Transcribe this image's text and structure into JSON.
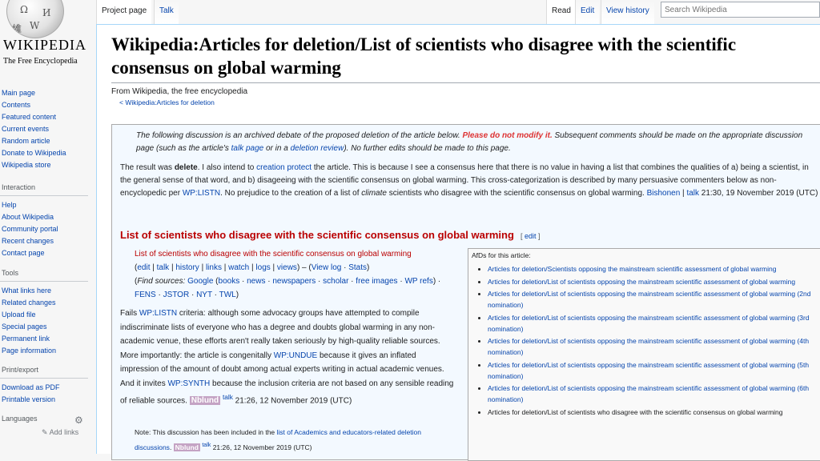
{
  "logo": {
    "wordmark": "WIKIPEDIA",
    "tagline": "The Free Encyclopedia"
  },
  "nav": {
    "main": [
      "Main page",
      "Contents",
      "Featured content",
      "Current events",
      "Random article",
      "Donate to Wikipedia",
      "Wikipedia store"
    ],
    "interaction_heading": "Interaction",
    "interaction": [
      "Help",
      "About Wikipedia",
      "Community portal",
      "Recent changes",
      "Contact page"
    ],
    "tools_heading": "Tools",
    "tools": [
      "What links here",
      "Related changes",
      "Upload file",
      "Special pages",
      "Permanent link",
      "Page information"
    ],
    "print_heading": "Print/export",
    "print": [
      "Download as PDF",
      "Printable version"
    ],
    "languages_heading": "Languages",
    "add_links": "Add links"
  },
  "tabs": {
    "project_page": "Project page",
    "talk": "Talk",
    "read": "Read",
    "edit": "Edit",
    "view_history": "View history"
  },
  "search": {
    "placeholder": "Search Wikipedia"
  },
  "page": {
    "title": "Wikipedia:Articles for deletion/List of scientists who disagree with the scientific consensus on global warming",
    "from": "From Wikipedia, the free encyclopedia",
    "breadcrumb": "< Wikipedia:Articles for deletion"
  },
  "notice": {
    "part1": "The following discussion is an archived debate of the proposed deletion of the article below. ",
    "warning": "Please do not modify it.",
    "part2": " Subsequent comments should be made on the appropriate discussion page (such as the article's ",
    "talk_page": "talk page",
    "part3": " or in a ",
    "deletion_review": "deletion review",
    "part4": "). No further edits should be made to this page."
  },
  "result": {
    "prefix": "The result was ",
    "verdict": "delete",
    "t1": ". I also intend to ",
    "creation_protect": "creation protect",
    "t2": " the article. This is because I see a consensus here that there is no value in having a list that combines the qualities of a) being a scientist, in the general sense of that word, and b) disageeing with the scientific consensus on global warming. This cross-categorization is described by many persuasive commenters below as non-encyclopedic per ",
    "wp_listn": "WP:LISTN",
    "t3": ". No prejudice to the creation of a list of ",
    "climate": "climate",
    "t4": " scientists who disagree with the scientific consensus on global warming. ",
    "user": "Bishonen",
    "talk": "talk",
    "time": " 21:30, 19 November 2019 (UTC)"
  },
  "section": {
    "heading": "List of scientists who disagree with the scientific consensus on global warming",
    "edit": "edit"
  },
  "article_links": {
    "article": "List of scientists who disagree with the scientific consensus on global warming",
    "edit": "edit",
    "talk": "talk",
    "history": "history",
    "links": "links",
    "watch": "watch",
    "logs": "logs",
    "views": "views",
    "view_log": "View log",
    "stats": "Stats",
    "find_sources": "Find sources:",
    "google": "Google",
    "books": "books",
    "news": "news",
    "newspapers": "newspapers",
    "scholar": "scholar",
    "free_images": "free images",
    "wp_refs": "WP refs",
    "fens": "FENS",
    "jstor": "JSTOR",
    "nyt": "NYT",
    "twl": "TWL"
  },
  "comment": {
    "t1": "Fails ",
    "wp_listn": "WP:LISTN",
    "t2": " criteria: although some advocacy groups have attempted to compile indiscriminate lists of everyone who has a degree and doubts global warming in any non-academic venue, these efforts aren't really taken seriously by high-quality reliable sources. More importantly: the article is congenitally ",
    "wp_undue": "WP:UNDUE",
    "t3": " because it gives an inflated impression of the amount of doubt among actual experts writing in actual academic venues. And it invites ",
    "wp_synth": "WP:SYNTH",
    "t4": " because the inclusion criteria are not based on any sensible reading of reliable sources. ",
    "user": "Nblund",
    "talk": "talk",
    "time": " 21:26, 12 November 2019 (UTC)"
  },
  "note": {
    "t1": "Note: This discussion has been included in the ",
    "link": "list of Academics and educators-related deletion discussions",
    "t2": ". ",
    "user": "Nblund",
    "talk": "talk",
    "time": " 21:26, 12 November 2019 (UTC)"
  },
  "afd": {
    "caption": "AfDs for this article:",
    "items": [
      "Articles for deletion/Scientists opposing the mainstream scientific assessment of global warming",
      "Articles for deletion/List of scientists opposing the mainstream scientific assessment of global warming",
      "Articles for deletion/List of scientists opposing the mainstream scientific assessment of global warming (2nd nomination)",
      "Articles for deletion/List of scientists opposing the mainstream scientific assessment of global warming (3rd nomination)",
      "Articles for deletion/List of scientists opposing the mainstream scientific assessment of global warming (4th nomination)",
      "Articles for deletion/List of scientists opposing the mainstream scientific assessment of global warming (5th nomination)",
      "Articles for deletion/List of scientists opposing the mainstream scientific assessment of global warming (6th nomination)",
      "Articles for deletion/List of scientists who disagree with the scientific consensus on global warming"
    ]
  },
  "colors": {
    "link": "#0645ad",
    "redlink": "#ba0000",
    "warning": "#d33",
    "archive_bg": "#f3f9ff",
    "signature_bg": "#c4a3c4"
  }
}
